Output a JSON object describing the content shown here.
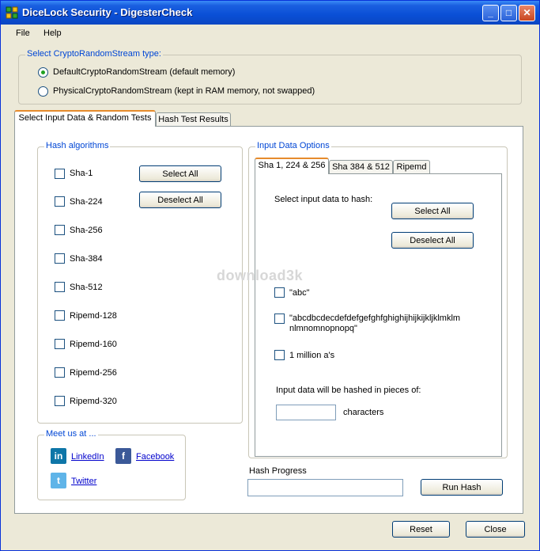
{
  "window": {
    "title": "DiceLock Security - DigesterCheck",
    "icon": "dicelock-app-icon"
  },
  "titlebar_buttons": {
    "minimize": "_",
    "maximize": "□",
    "close": "✕"
  },
  "menu": {
    "file": "File",
    "help": "Help"
  },
  "stream_group": {
    "label": "Select CryptoRandomStream type:",
    "options": [
      {
        "label": "DefaultCryptoRandomStream (default memory)",
        "selected": true
      },
      {
        "label": "PhysicalCryptoRandomStream (kept in RAM memory, not swapped)",
        "selected": false
      }
    ]
  },
  "main_tabs": [
    "Select Input Data & Random Tests",
    "Hash Test Results"
  ],
  "hash_algorithms": {
    "label": "Hash algorithms",
    "items": [
      "Sha-1",
      "Sha-224",
      "Sha-256",
      "Sha-384",
      "Sha-512",
      "Ripemd-128",
      "Ripemd-160",
      "Ripemd-256",
      "Ripemd-320"
    ],
    "select_all": "Select All",
    "deselect_all": "Deselect All"
  },
  "input_options": {
    "label": "Input Data Options",
    "tabs": [
      "Sha 1, 224 & 256",
      "Sha 384 & 512",
      "Ripemd"
    ],
    "select_prompt": "Select input data to hash:",
    "select_all": "Select All",
    "deselect_all": "Deselect All",
    "items": [
      "\"abc\"",
      "\"abcdbcdecdefdefgefghfghighijhijkijkljklmklmnlmnomnopnopq\"",
      "1 million a's"
    ],
    "pieces_label": "Input data will be hashed in pieces of:",
    "pieces_value": "",
    "characters_label": "characters"
  },
  "meet_us": {
    "label": "Meet us at ...",
    "linkedin": "LinkedIn",
    "facebook": "Facebook",
    "twitter": "Twitter"
  },
  "progress": {
    "label": "Hash Progress",
    "value": 0
  },
  "buttons": {
    "run_hash": "Run Hash",
    "reset": "Reset",
    "close": "Close"
  },
  "watermark": "download3k",
  "colors": {
    "title_bar": "#0a4fd6",
    "group_label": "#0046d5",
    "link": "#0000cc",
    "active_tab_accent": "#e68b2c"
  }
}
